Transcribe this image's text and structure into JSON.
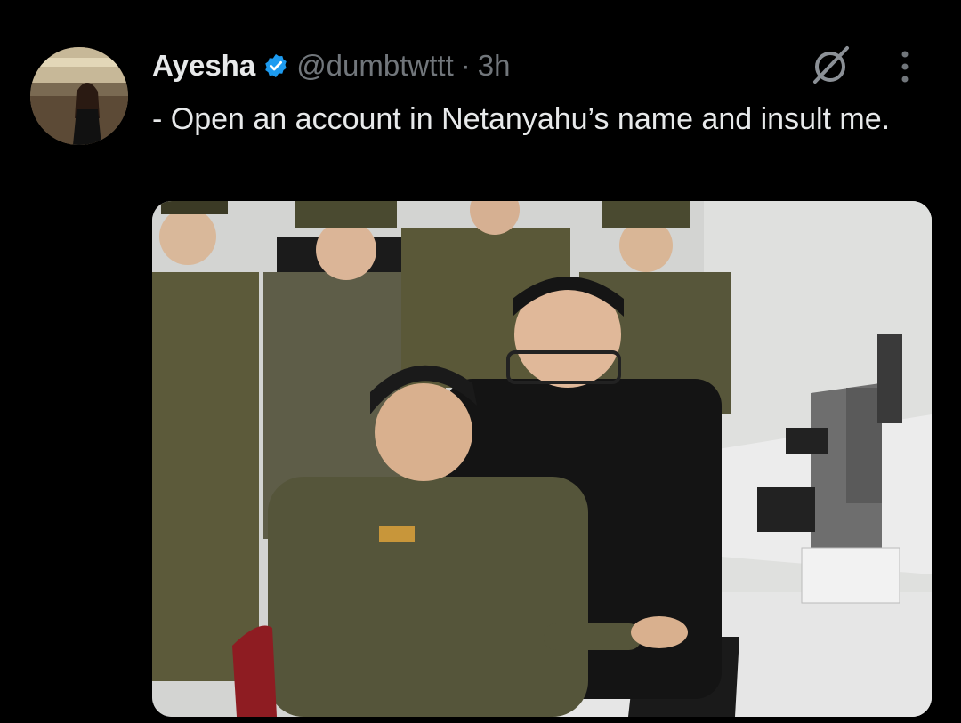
{
  "tweet": {
    "author_name": "Ayesha",
    "handle": "@dumbtwttt",
    "separator": "·",
    "time_ago": "3h",
    "text": "- Open an account in Netanyahu’s name and insult me."
  },
  "icons": {
    "verified": "verified-badge-icon",
    "grok": "grok-icon",
    "more": "more-vertical-icon"
  },
  "colors": {
    "background": "#000000",
    "text": "#e7e9ea",
    "muted": "#71767b",
    "verified": "#1d9bf0"
  }
}
